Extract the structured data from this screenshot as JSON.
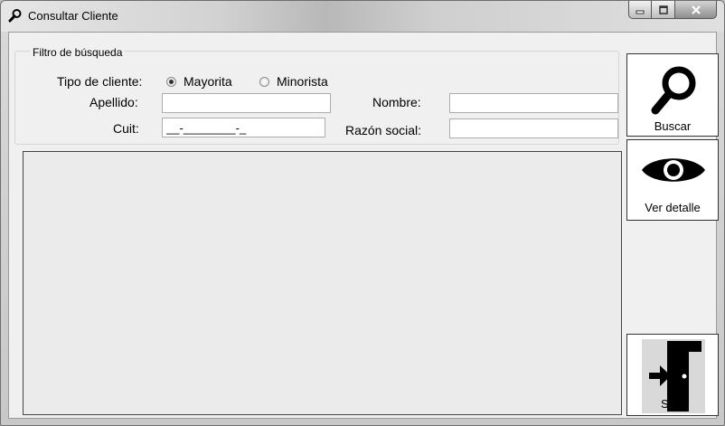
{
  "window": {
    "title": "Consultar Cliente"
  },
  "filter": {
    "group_title": "Filtro de búsqueda",
    "tipo_label": "Tipo de cliente:",
    "radio_mayorista": "Mayorita",
    "radio_minorista": "Minorista",
    "selected": "Mayorita",
    "apellido_label": "Apellido:",
    "apellido_value": "",
    "nombre_label": "Nombre:",
    "nombre_value": "",
    "cuit_label": "Cuit:",
    "cuit_value": "__-________-_",
    "razon_label": "Razón social:",
    "razon_value": ""
  },
  "buttons": {
    "buscar": "Buscar",
    "ver_detalle": "Ver detalle",
    "salir": "Salir"
  }
}
